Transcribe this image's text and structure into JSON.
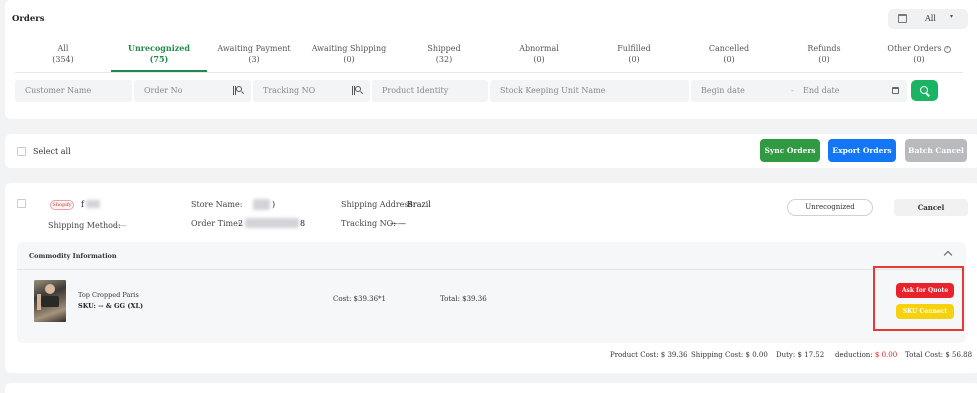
{
  "header": {
    "title": "Orders",
    "store_filter": "All"
  },
  "tabs": [
    {
      "label": "All",
      "count": "(354)"
    },
    {
      "label": "Unrecognized",
      "count": "(75)"
    },
    {
      "label": "Awaiting Payment",
      "count": "(3)"
    },
    {
      "label": "Awaiting Shipping",
      "count": "(0)"
    },
    {
      "label": "Shipped",
      "count": "(32)"
    },
    {
      "label": "Abnormal",
      "count": "(0)"
    },
    {
      "label": "Fulfilled",
      "count": "(0)"
    },
    {
      "label": "Cancelled",
      "count": "(0)"
    },
    {
      "label": "Refunds",
      "count": "(0)"
    },
    {
      "label": "Other Orders",
      "count": "(0)"
    }
  ],
  "active_tab": "Unrecognized",
  "filters": {
    "customer_name": "Customer Name",
    "order_no": "Order No",
    "tracking_no": "Tracking NO",
    "product_identity": "Product Identity",
    "sku": "Stock Keeping Unit Name",
    "begin_date": "Begin date",
    "date_separator": "-",
    "end_date": "End date"
  },
  "actions": {
    "select_all": "Select all",
    "sync": "Sync Orders",
    "export": "Export Orders",
    "batch_cancel": "Batch Cancel"
  },
  "order": {
    "platform_badge": "Shopify",
    "shop_initial": "f",
    "store_name_label": "Store Name:",
    "store_name_suffix": ")",
    "order_time_label": "Order Time:",
    "order_time_prefix": "2",
    "order_time_suffix": "8",
    "shipping_address_label": "Shipping Address:",
    "shipping_address": "Brazil",
    "shipping_method_label": "Shipping Method:",
    "shipping_method": "——",
    "tracking_label": "Tracking NO:",
    "tracking_value": "——",
    "status": "Unrecognized",
    "cancel": "Cancel",
    "commodity_title": "Commodity Information",
    "item": {
      "name": "Top Cropped Paris",
      "sku": "SKU: -- & GG (XL)",
      "cost": "Cost: $39.36*1",
      "total": "Total: $39.36",
      "ask_quote": "Ask for Quote",
      "sku_connect": "SKU Connect"
    },
    "totals": {
      "product_cost_label": "Product Cost:",
      "product_cost": "$ 39.36",
      "shipping_cost_label": "Shipping Cost:",
      "shipping_cost": "$ 0.00",
      "duty_label": "Duty:",
      "duty": "$ 17.52",
      "deduction_label": "deduction:",
      "deduction": "$ 0.00",
      "total_cost_label": "Total Cost:",
      "total_cost": "$ 56.88"
    }
  },
  "colors": {
    "accent_green": "#1e8c4a",
    "sync_green": "#2f9a41",
    "export_blue": "#1377f5",
    "quote_red": "#e8232b",
    "sku_yellow": "#f6d10d",
    "highlight_red": "#e53935"
  }
}
